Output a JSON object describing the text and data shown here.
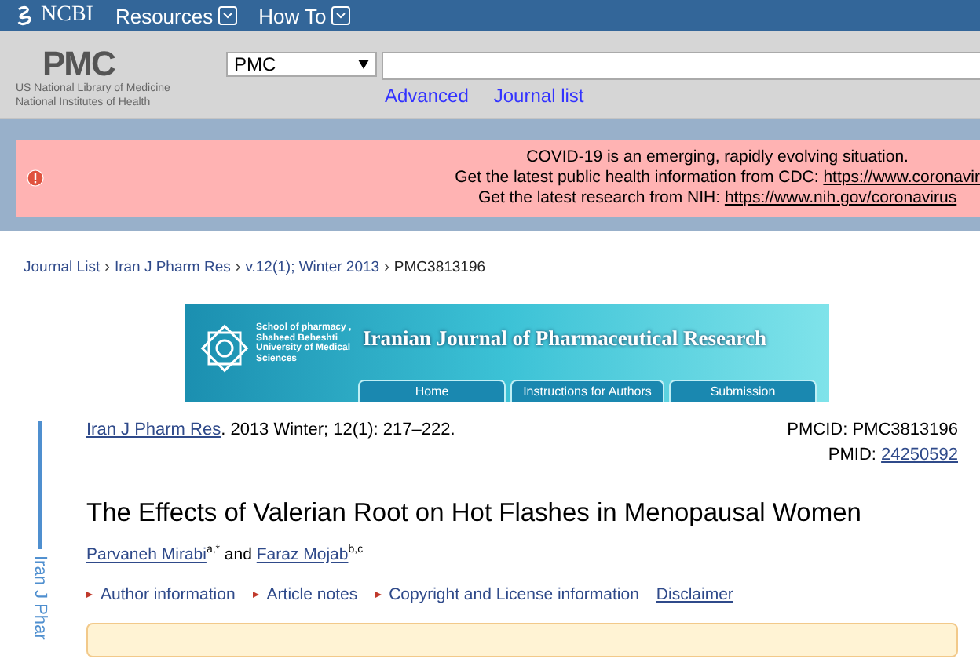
{
  "topbar": {
    "brand": "NCBI",
    "menus": [
      "Resources",
      "How To"
    ]
  },
  "header": {
    "logo": "PMC",
    "logo_lines": [
      "US National Library of Medicine",
      "National Institutes of Health"
    ],
    "database": "PMC",
    "links": [
      "Advanced",
      "Journal list"
    ]
  },
  "alert": {
    "lines": [
      {
        "text": "COVID-19 is an emerging, rapidly evolving situation."
      },
      {
        "text": "Get the latest public health information from CDC:",
        "link": "https://www.coronavir"
      },
      {
        "text": "Get the latest research from NIH:",
        "link": "https://www.nih.gov/coronavirus"
      }
    ]
  },
  "breadcrumb_separator": "›",
  "breadcrumb": [
    {
      "label": "Journal List",
      "link": true
    },
    {
      "label": "Iran J Pharm Res",
      "link": true
    },
    {
      "label": "v.12(1); Winter 2013",
      "link": true
    },
    {
      "label": "PMC3813196",
      "link": false
    }
  ],
  "banner": {
    "school": [
      "School of pharmacy ,",
      "Shaheed Beheshti",
      "University of Medical",
      "Sciences"
    ],
    "title": "Iranian Journal of Pharmaceutical Research",
    "tabs": [
      "Home",
      "Instructions for Authors",
      "Submission"
    ]
  },
  "side_label": "Iran J Phar",
  "citation": {
    "journal": "Iran J Pharm Res",
    "details": ". 2013 Winter; 12(1): 217–222.",
    "pmcid": "PMCID: PMC3813196",
    "pmid_label": "PMID:",
    "pmid": "24250592"
  },
  "title": "The Effects of Valerian Root on Hot Flashes in Menopausal Women",
  "authors": [
    {
      "name": "Parvaneh Mirabi",
      "affiliation": "a,*"
    },
    {
      "name": "Faraz Mojab",
      "affiliation": "b,c"
    }
  ],
  "authors_joiner": "and",
  "article_links": [
    {
      "label": "Author information",
      "kind": "toggle"
    },
    {
      "label": "Article notes",
      "kind": "toggle"
    },
    {
      "label": "Copyright and License information",
      "kind": "toggle"
    },
    {
      "label": "Disclaimer",
      "kind": "link"
    }
  ]
}
